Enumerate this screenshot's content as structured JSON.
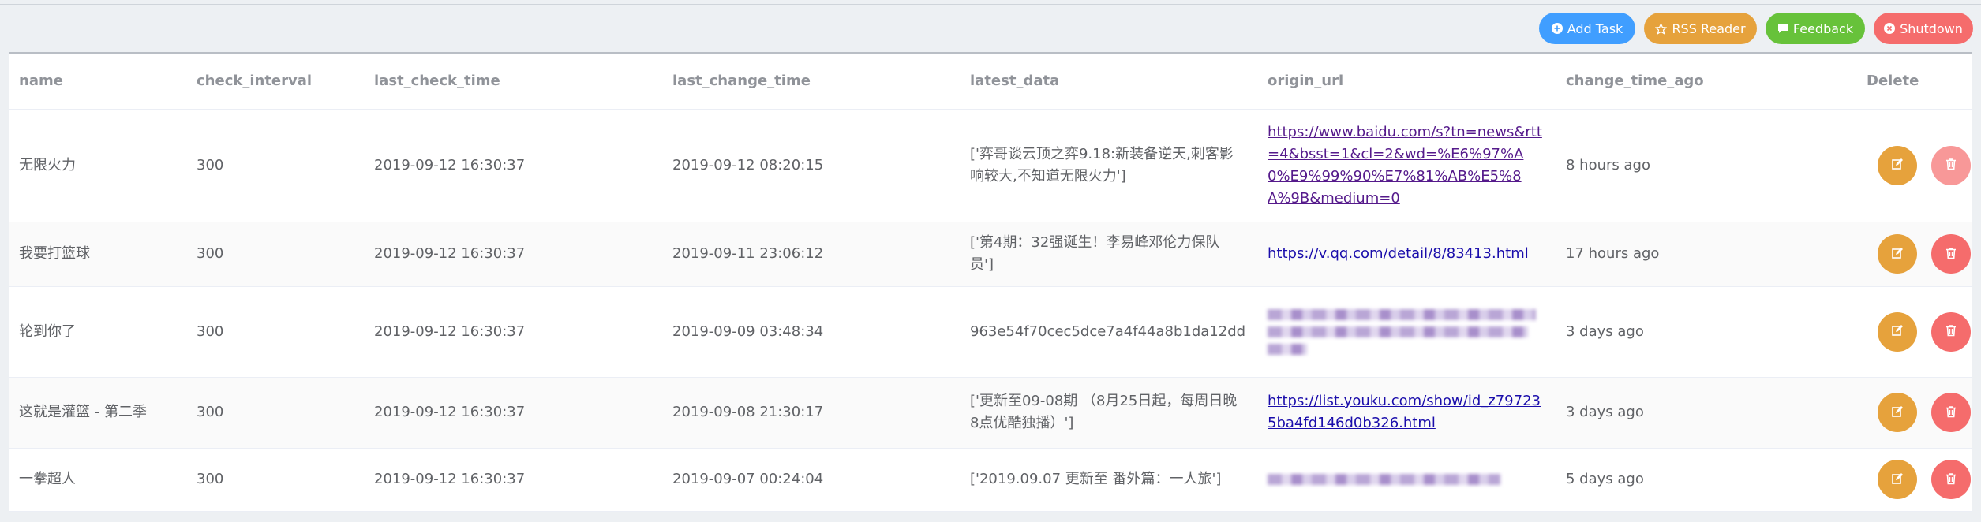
{
  "toolbar": {
    "add_task": "Add Task",
    "rss_reader": "RSS Reader",
    "feedback": "Feedback",
    "shutdown": "Shutdown"
  },
  "table": {
    "columns": [
      "name",
      "check_interval",
      "last_check_time",
      "last_change_time",
      "latest_data",
      "origin_url",
      "change_time_ago",
      "Delete"
    ],
    "rows": [
      {
        "name": "无限火力",
        "check_interval": "300",
        "last_check_time": "2019-09-12 16:30:37",
        "last_change_time": "2019-09-12 08:20:15",
        "latest_data": "['弈哥谈云顶之弈9.18:新装备逆天,刺客影响较大,不知道无限火力']",
        "origin_url": "https://www.baidu.com/s?tn=news&rtt=4&bsst=1&cl=2&wd=%E6%97%A0%E9%99%90%E7%81%AB%E5%8A%9B&medium=0",
        "change_time_ago": "8 hours ago"
      },
      {
        "name": "我要打篮球",
        "check_interval": "300",
        "last_check_time": "2019-09-12 16:30:37",
        "last_change_time": "2019-09-11 23:06:12",
        "latest_data": "['第4期：32强诞生！李易峰邓伦力保队员']",
        "origin_url": "https://v.qq.com/detail/8/83413.html",
        "change_time_ago": "17 hours ago"
      },
      {
        "name": "轮到你了",
        "check_interval": "300",
        "last_check_time": "2019-09-12 16:30:37",
        "last_change_time": "2019-09-09 03:48:34",
        "latest_data": "963e54f70cec5dce7a4f44a8b1da12dd",
        "origin_url": "",
        "change_time_ago": "3 days ago"
      },
      {
        "name": "这就是灌篮 - 第二季",
        "check_interval": "300",
        "last_check_time": "2019-09-12 16:30:37",
        "last_change_time": "2019-09-08 21:30:17",
        "latest_data": "['更新至09-08期 （8月25日起，每周日晚8点优酷独播）']",
        "origin_url": "https://list.youku.com/show/id_z797235ba4fd146d0b326.html",
        "change_time_ago": "3 days ago"
      },
      {
        "name": "一拳超人",
        "check_interval": "300",
        "last_check_time": "2019-09-12 16:30:37",
        "last_change_time": "2019-09-07 00:24:04",
        "latest_data": "['2019.09.07 更新至 番外篇：一人旅']",
        "origin_url": "",
        "change_time_ago": "5 days ago"
      }
    ]
  }
}
